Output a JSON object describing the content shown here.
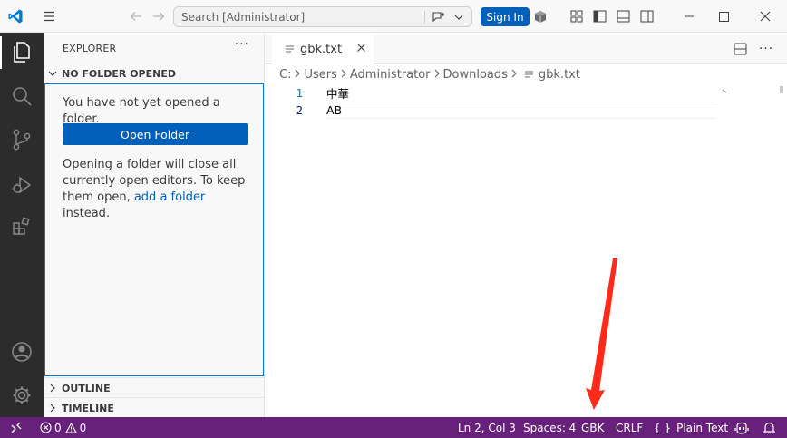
{
  "titlebar": {
    "search_placeholder": "Search [Administrator]",
    "signin_label": "Sign In"
  },
  "sidebar": {
    "title": "EXPLORER",
    "more": "···",
    "no_folder_header": "NO FOLDER OPENED",
    "message1": "You have not yet opened a folder.",
    "open_folder_label": "Open Folder",
    "message2_pre": "Opening a folder will close all currently open editors. To keep them open, ",
    "message2_link": "add a folder",
    "message2_post": " instead.",
    "outline_header": "OUTLINE",
    "timeline_header": "TIMELINE"
  },
  "editor": {
    "tab_label": "gbk.txt",
    "breadcrumb": [
      "C:",
      "Users",
      "Administrator",
      "Downloads",
      "gbk.txt"
    ],
    "lines": [
      {
        "number": "1",
        "text": "中華"
      },
      {
        "number": "2",
        "text": "AB"
      }
    ]
  },
  "statusbar": {
    "errors": "0",
    "warnings": "0",
    "position": "Ln 2, Col 3",
    "spaces": "Spaces: 4",
    "encoding": "GBK",
    "eol": "CRLF",
    "language": "Plain Text",
    "language_brace": "{ }"
  },
  "colors": {
    "statusbar_bg": "#68217a",
    "accent": "#005fb8",
    "annotation_arrow": "#ff2a1a"
  }
}
